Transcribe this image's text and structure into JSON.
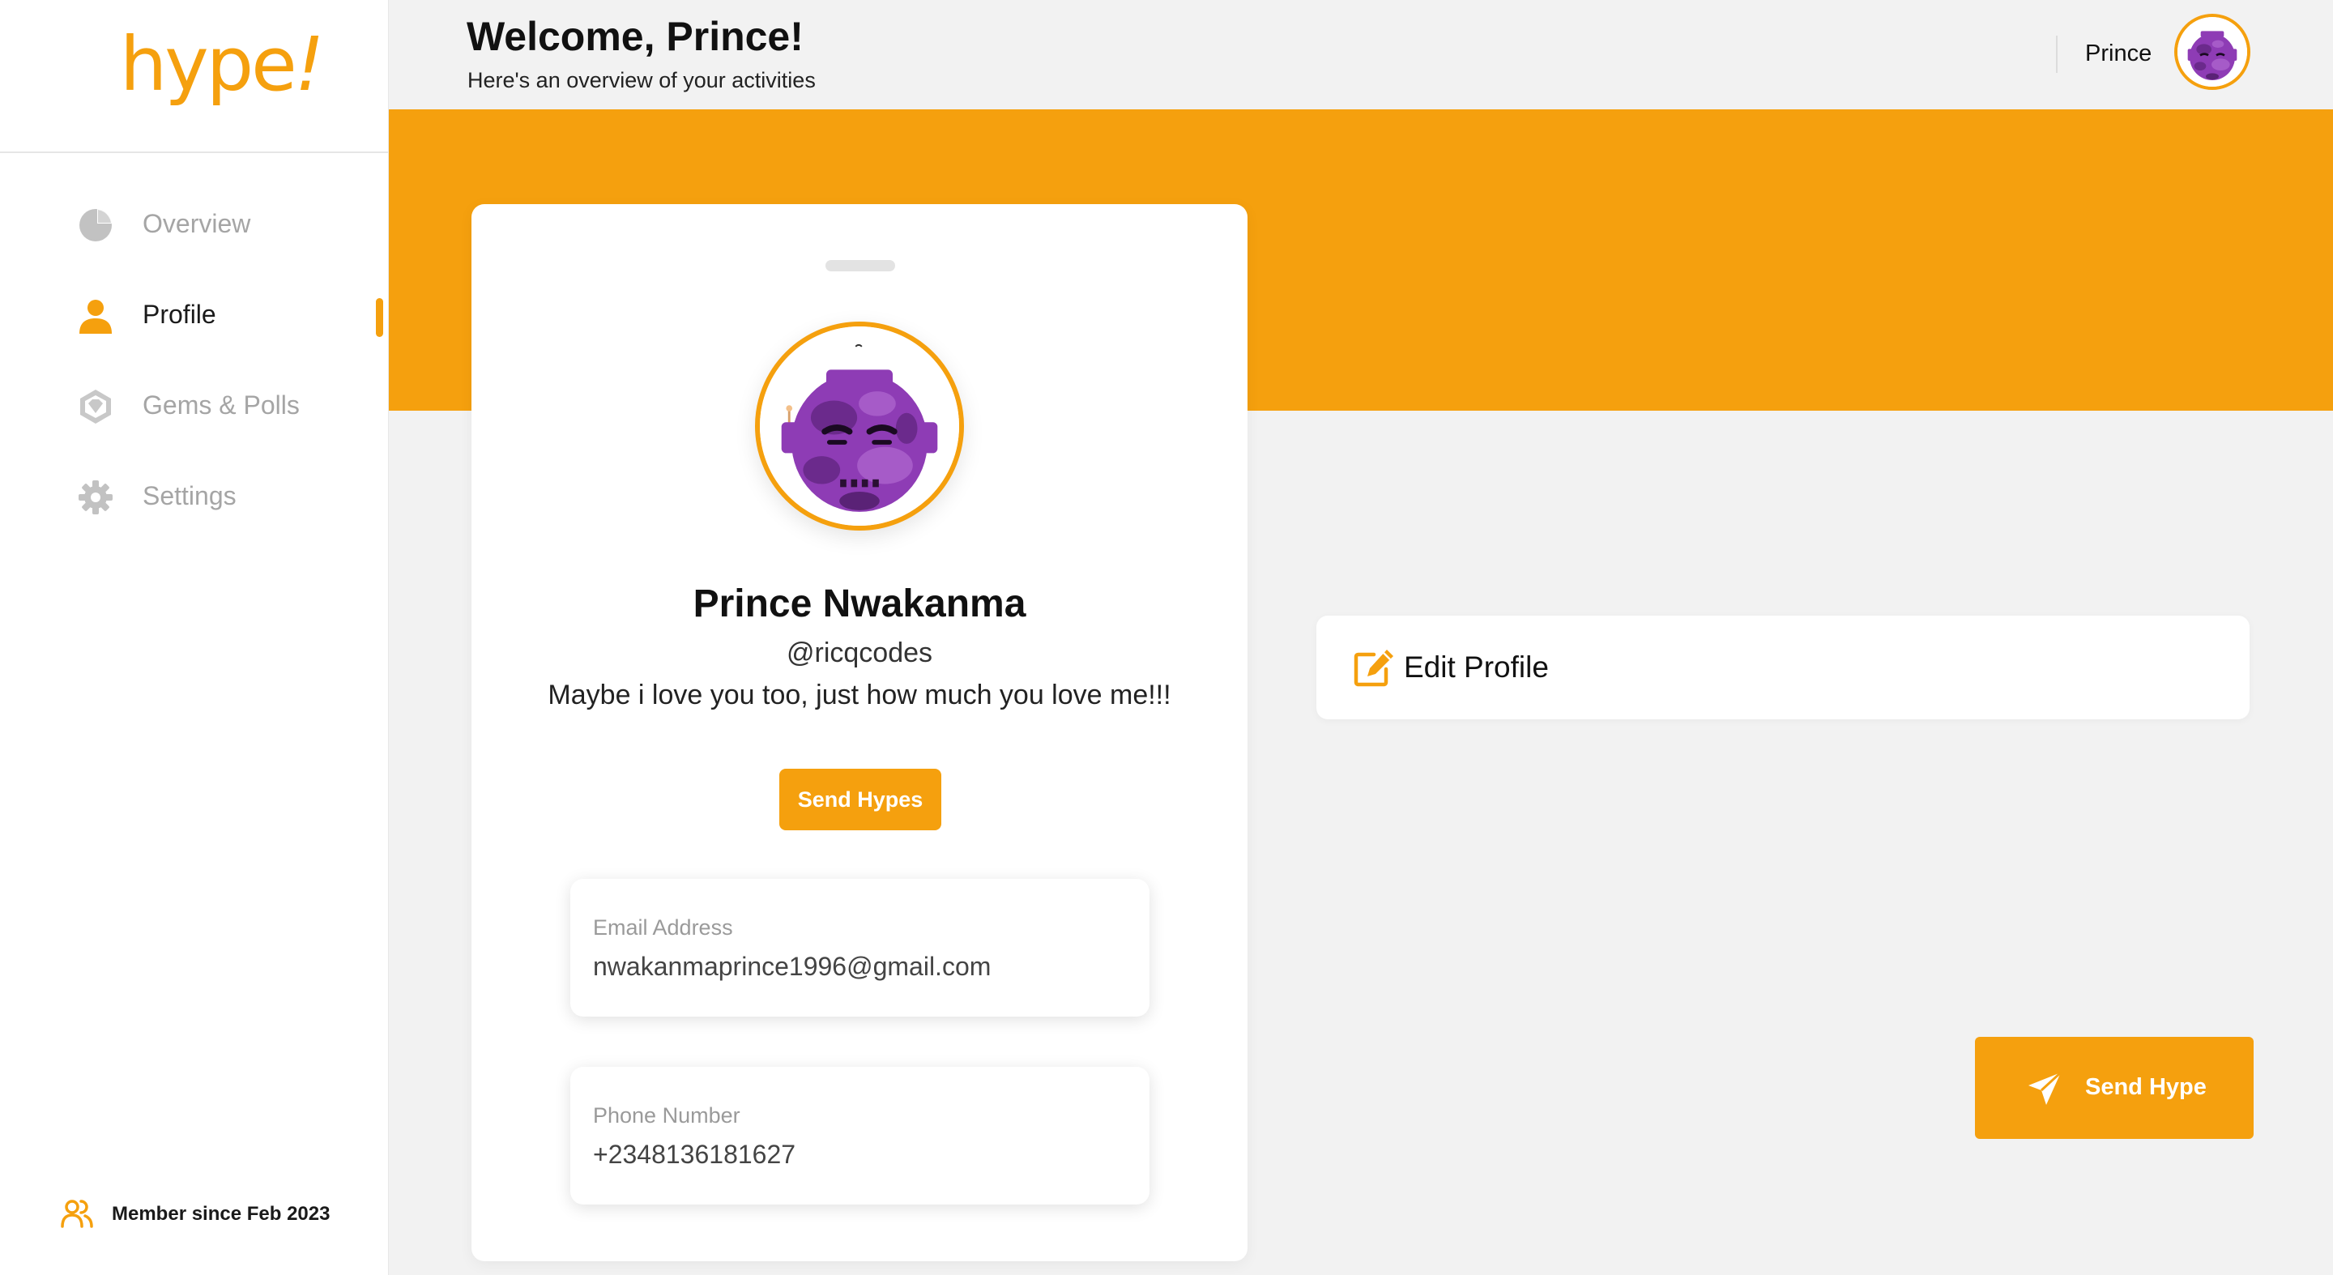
{
  "app": {
    "logo_text": "hype",
    "logo_bang": "!"
  },
  "sidebar": {
    "items": [
      {
        "label": "Overview",
        "icon": "pie-chart-icon",
        "active": false
      },
      {
        "label": "Profile",
        "icon": "user-icon",
        "active": true
      },
      {
        "label": "Gems & Polls",
        "icon": "gem-icon",
        "active": false
      },
      {
        "label": "Settings",
        "icon": "gear-icon",
        "active": false
      }
    ],
    "member_since": "Member since Feb 2023"
  },
  "header": {
    "title": "Welcome, Prince!",
    "subtitle": "Here's an overview of your activities",
    "user_name": "Prince"
  },
  "profile": {
    "name": "Prince Nwakanma",
    "handle": "@ricqcodes",
    "bio": "Maybe i love you too, just how much you love me!!!",
    "send_button": "Send Hypes",
    "email_label": "Email Address",
    "email": "nwakanmaprince1996@gmail.com",
    "phone_label": "Phone Number",
    "phone": "+2348136181627"
  },
  "actions": {
    "edit_profile": "Edit Profile",
    "send_hype": "Send Hype"
  },
  "colors": {
    "accent": "#F5A00E",
    "avatar": "#8E3CB5",
    "muted": "#a5a5a5"
  }
}
